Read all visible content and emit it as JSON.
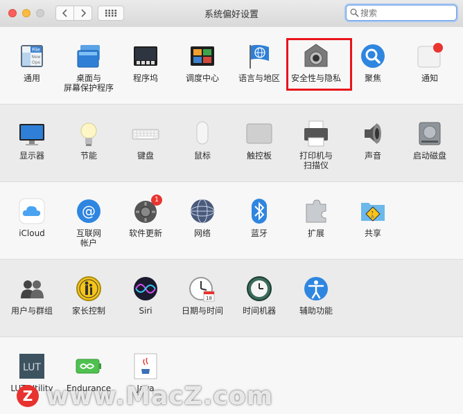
{
  "window": {
    "title": "系统偏好设置",
    "search_placeholder": "搜索"
  },
  "rows": [
    {
      "items": [
        {
          "label": "通用",
          "icon": "general-icon",
          "badge": null
        },
        {
          "label": "桌面与\n屏幕保护程序",
          "icon": "desktop-screensaver-icon",
          "badge": null
        },
        {
          "label": "程序坞",
          "icon": "dock-icon",
          "badge": null
        },
        {
          "label": "调度中心",
          "icon": "mission-control-icon",
          "badge": null
        },
        {
          "label": "语言与地区",
          "icon": "language-region-icon",
          "badge": null
        },
        {
          "label": "安全性与隐私",
          "icon": "security-privacy-icon",
          "badge": null
        },
        {
          "label": "聚焦",
          "icon": "spotlight-icon",
          "badge": null
        },
        {
          "label": "通知",
          "icon": "notifications-icon",
          "badge": null
        }
      ]
    },
    {
      "items": [
        {
          "label": "显示器",
          "icon": "displays-icon",
          "badge": null
        },
        {
          "label": "节能",
          "icon": "energy-saver-icon",
          "badge": null
        },
        {
          "label": "键盘",
          "icon": "keyboard-icon",
          "badge": null
        },
        {
          "label": "鼠标",
          "icon": "mouse-icon",
          "badge": null
        },
        {
          "label": "触控板",
          "icon": "trackpad-icon",
          "badge": null
        },
        {
          "label": "打印机与\n扫描仪",
          "icon": "printers-scanners-icon",
          "badge": null
        },
        {
          "label": "声音",
          "icon": "sound-icon",
          "badge": null
        },
        {
          "label": "启动磁盘",
          "icon": "startup-disk-icon",
          "badge": null
        }
      ]
    },
    {
      "items": [
        {
          "label": "iCloud",
          "icon": "icloud-icon",
          "badge": null
        },
        {
          "label": "互联网\n帐户",
          "icon": "internet-accounts-icon",
          "badge": null
        },
        {
          "label": "软件更新",
          "icon": "software-update-icon",
          "badge": "1"
        },
        {
          "label": "网络",
          "icon": "network-icon",
          "badge": null
        },
        {
          "label": "蓝牙",
          "icon": "bluetooth-icon",
          "badge": null
        },
        {
          "label": "扩展",
          "icon": "extensions-icon",
          "badge": null
        },
        {
          "label": "共享",
          "icon": "sharing-icon",
          "badge": null
        }
      ]
    },
    {
      "items": [
        {
          "label": "用户与群组",
          "icon": "users-groups-icon",
          "badge": null
        },
        {
          "label": "家长控制",
          "icon": "parental-controls-icon",
          "badge": null
        },
        {
          "label": "Siri",
          "icon": "siri-icon",
          "badge": null
        },
        {
          "label": "日期与时间",
          "icon": "date-time-icon",
          "badge": null
        },
        {
          "label": "时间机器",
          "icon": "time-machine-icon",
          "badge": null
        },
        {
          "label": "辅助功能",
          "icon": "accessibility-icon",
          "badge": null
        }
      ]
    },
    {
      "items": [
        {
          "label": "LUT Utility",
          "icon": "lut-utility-icon",
          "badge": null
        },
        {
          "label": "Endurance",
          "icon": "endurance-icon",
          "badge": null
        },
        {
          "label": "Java",
          "icon": "java-icon",
          "badge": null
        }
      ]
    }
  ],
  "watermark": {
    "logo_letter": "Z",
    "text": "www.MacZ.com"
  },
  "highlight_color": "#e8131a"
}
